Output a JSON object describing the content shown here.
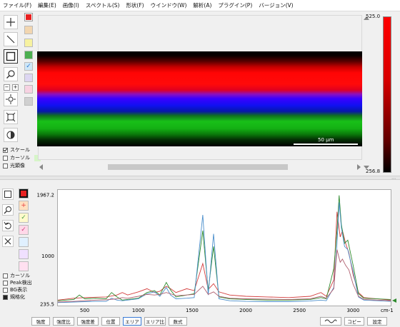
{
  "menu": [
    "ファイル(F)",
    "編集(E)",
    "画像(I)",
    "スペクトル(S)",
    "形状(F)",
    "ウインドウ(W)",
    "解析(A)",
    "プラグイン(P)",
    "バージョン(V)"
  ],
  "image_panel": {
    "scale_bar_label": "50 µm",
    "colorbar_max": "525.0",
    "colorbar_min": "256.8",
    "options": [
      {
        "label": "スケール",
        "checked": true
      },
      {
        "label": "カーソル",
        "checked": false
      },
      {
        "label": "光顕像",
        "checked": false
      }
    ],
    "swatch_colors": [
      "#e82020",
      "#f2d6b0",
      "#f7f2a0",
      "#4caf50",
      "#cfe7f7",
      "#ddd6f2",
      "#f7d2e2",
      "#d0d0d0"
    ]
  },
  "spectrum_panel": {
    "options": [
      {
        "label": "カーソル",
        "checked": false
      },
      {
        "label": "Peak検出",
        "checked": false
      },
      {
        "label": "BG表示",
        "checked": false
      },
      {
        "label": "規格化",
        "checked": true
      }
    ],
    "swatch_colors": [
      "#e82020",
      "#ffe0c0",
      "#fffacc",
      "#ffd8e8",
      "#e0f0ff",
      "#f0e0ff",
      "#ffe0f0",
      "#fff080"
    ],
    "bottom_buttons": [
      "強度",
      "強度比",
      "強度差",
      "位置",
      "エリア",
      "エリア比",
      "数式"
    ],
    "action_buttons": [
      "コピー",
      "設定"
    ]
  },
  "chart_data": {
    "type": "line",
    "xlabel": "cm-1",
    "ylabel": "",
    "xlim": [
      250,
      3350
    ],
    "ylim": [
      235.5,
      1967.2
    ],
    "y_ticks": [
      235.5,
      1000,
      1967.2
    ],
    "x_ticks": [
      500,
      1000,
      1500,
      2000,
      2500,
      3000
    ],
    "series": [
      {
        "color": "#d33c3c",
        "points": [
          [
            250,
            300
          ],
          [
            400,
            330
          ],
          [
            500,
            340
          ],
          [
            600,
            345
          ],
          [
            700,
            350
          ],
          [
            800,
            380
          ],
          [
            850,
            420
          ],
          [
            900,
            380
          ],
          [
            1000,
            430
          ],
          [
            1080,
            480
          ],
          [
            1150,
            420
          ],
          [
            1200,
            440
          ],
          [
            1260,
            520
          ],
          [
            1300,
            480
          ],
          [
            1350,
            420
          ],
          [
            1450,
            480
          ],
          [
            1520,
            450
          ],
          [
            1600,
            880
          ],
          [
            1650,
            470
          ],
          [
            1700,
            560
          ],
          [
            1750,
            430
          ],
          [
            1850,
            380
          ],
          [
            2000,
            360
          ],
          [
            2200,
            350
          ],
          [
            2400,
            340
          ],
          [
            2600,
            360
          ],
          [
            2700,
            420
          ],
          [
            2750,
            360
          ],
          [
            2820,
            620
          ],
          [
            2850,
            1700
          ],
          [
            2880,
            1300
          ],
          [
            2900,
            1400
          ],
          [
            2930,
            1200
          ],
          [
            2960,
            1050
          ],
          [
            3000,
            700
          ],
          [
            3050,
            420
          ],
          [
            3100,
            340
          ],
          [
            3350,
            300
          ]
        ]
      },
      {
        "color": "#2e8b2e",
        "points": [
          [
            250,
            290
          ],
          [
            400,
            310
          ],
          [
            450,
            380
          ],
          [
            500,
            320
          ],
          [
            600,
            330
          ],
          [
            700,
            320
          ],
          [
            750,
            420
          ],
          [
            800,
            350
          ],
          [
            850,
            300
          ],
          [
            900,
            310
          ],
          [
            1000,
            330
          ],
          [
            1080,
            420
          ],
          [
            1150,
            450
          ],
          [
            1200,
            380
          ],
          [
            1260,
            580
          ],
          [
            1300,
            460
          ],
          [
            1350,
            350
          ],
          [
            1450,
            380
          ],
          [
            1520,
            400
          ],
          [
            1600,
            1400
          ],
          [
            1650,
            450
          ],
          [
            1700,
            1150
          ],
          [
            1750,
            350
          ],
          [
            1850,
            320
          ],
          [
            2000,
            310
          ],
          [
            2200,
            300
          ],
          [
            2400,
            300
          ],
          [
            2600,
            310
          ],
          [
            2700,
            340
          ],
          [
            2750,
            320
          ],
          [
            2820,
            800
          ],
          [
            2850,
            1400
          ],
          [
            2870,
            1960
          ],
          [
            2890,
            1500
          ],
          [
            2920,
            1200
          ],
          [
            2950,
            1250
          ],
          [
            3000,
            850
          ],
          [
            3050,
            400
          ],
          [
            3100,
            330
          ],
          [
            3350,
            310
          ]
        ]
      },
      {
        "color": "#4a8ecb",
        "points": [
          [
            250,
            260
          ],
          [
            400,
            270
          ],
          [
            500,
            275
          ],
          [
            600,
            280
          ],
          [
            700,
            280
          ],
          [
            750,
            330
          ],
          [
            800,
            300
          ],
          [
            850,
            290
          ],
          [
            900,
            300
          ],
          [
            1000,
            320
          ],
          [
            1080,
            400
          ],
          [
            1150,
            430
          ],
          [
            1200,
            360
          ],
          [
            1260,
            500
          ],
          [
            1300,
            380
          ],
          [
            1350,
            320
          ],
          [
            1450,
            330
          ],
          [
            1520,
            340
          ],
          [
            1600,
            1650
          ],
          [
            1650,
            380
          ],
          [
            1700,
            1350
          ],
          [
            1750,
            320
          ],
          [
            1850,
            290
          ],
          [
            2000,
            280
          ],
          [
            2200,
            275
          ],
          [
            2400,
            275
          ],
          [
            2600,
            285
          ],
          [
            2700,
            300
          ],
          [
            2750,
            290
          ],
          [
            2820,
            500
          ],
          [
            2850,
            1200
          ],
          [
            2870,
            1850
          ],
          [
            2890,
            1450
          ],
          [
            2920,
            1150
          ],
          [
            2950,
            1100
          ],
          [
            3000,
            750
          ],
          [
            3050,
            350
          ],
          [
            3100,
            300
          ],
          [
            3350,
            280
          ]
        ]
      },
      {
        "color": "#b06070",
        "points": [
          [
            250,
            270
          ],
          [
            400,
            280
          ],
          [
            500,
            290
          ],
          [
            600,
            300
          ],
          [
            700,
            305
          ],
          [
            800,
            320
          ],
          [
            850,
            340
          ],
          [
            900,
            330
          ],
          [
            1000,
            360
          ],
          [
            1080,
            390
          ],
          [
            1150,
            380
          ],
          [
            1200,
            390
          ],
          [
            1260,
            420
          ],
          [
            1300,
            400
          ],
          [
            1350,
            370
          ],
          [
            1450,
            380
          ],
          [
            1520,
            390
          ],
          [
            1600,
            520
          ],
          [
            1650,
            390
          ],
          [
            1700,
            430
          ],
          [
            1750,
            360
          ],
          [
            1850,
            330
          ],
          [
            2000,
            320
          ],
          [
            2200,
            315
          ],
          [
            2400,
            310
          ],
          [
            2600,
            320
          ],
          [
            2700,
            360
          ],
          [
            2750,
            330
          ],
          [
            2820,
            480
          ],
          [
            2850,
            1100
          ],
          [
            2880,
            900
          ],
          [
            2900,
            950
          ],
          [
            2930,
            850
          ],
          [
            2960,
            780
          ],
          [
            3000,
            550
          ],
          [
            3050,
            360
          ],
          [
            3100,
            310
          ],
          [
            3350,
            290
          ]
        ]
      }
    ]
  }
}
